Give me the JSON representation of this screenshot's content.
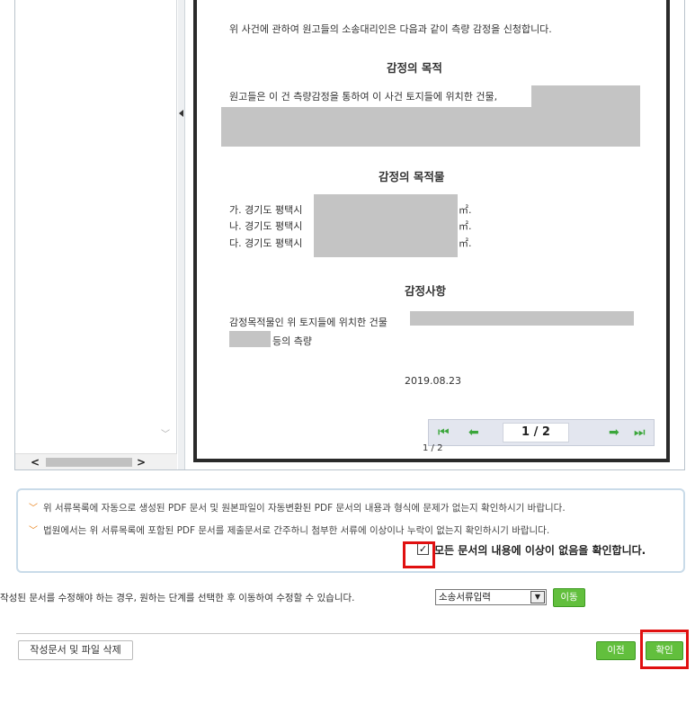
{
  "viewer": {
    "document": {
      "intro": "위 사건에 관하여 원고들의 소송대리인은 다음과 같이 측량 감정을 신청합니다.",
      "section1_title": "감정의 목적",
      "section1_text": "원고들은 이 건 측량감정을 통하여 이 사건 토지들에 위치한 건물,",
      "section2_title": "감정의 목적물",
      "items": [
        {
          "prefix": "가. 경기도 평택시",
          "unit": "㎡."
        },
        {
          "prefix": "나. 경기도 평택시",
          "unit": "㎡."
        },
        {
          "prefix": "다. 경기도 평택시",
          "unit": "㎡."
        }
      ],
      "section3_title": "감정사항",
      "section3_text1": "감정목적물인 위 토지들에 위치한 건물",
      "section3_text2": "등의 측량",
      "date": "2019.08.23"
    },
    "pager": {
      "current": "1 / 2",
      "below_label": "1 / 2"
    },
    "scroll": {
      "left": "<",
      "right": ">",
      "down": "﹀"
    }
  },
  "notice": {
    "line1": "위 서류목록에 자동으로 생성된 PDF 문서 및 원본파일이 자동변환된 PDF 문서의 내용과 형식에 문제가 없는지 확인하시기 바랍니다.",
    "line2": "법원에서는 위 서류목록에 포함된 PDF 문서를 제출문서로 간주하니 첨부한 서류에 이상이나 누락이 없는지 확인하시기 바랍니다.",
    "confirm_label": "모든 문서의 내용에 이상이 없음을 확인합니다.",
    "confirm_checked": true
  },
  "step": {
    "text": "작성된 문서를 수정해야 하는 경우, 원하는 단계를 선택한 후 이동하여 수정할 수 있습니다.",
    "selected": "소송서류입력",
    "move_label": "이동"
  },
  "footer": {
    "delete_label": "작성문서 및 파일 삭제",
    "prev_label": "이전",
    "confirm_label": "확인"
  },
  "colors": {
    "accent_green": "#62bf3d",
    "highlight_red": "#e01010",
    "chevron_orange": "#e8821a"
  }
}
